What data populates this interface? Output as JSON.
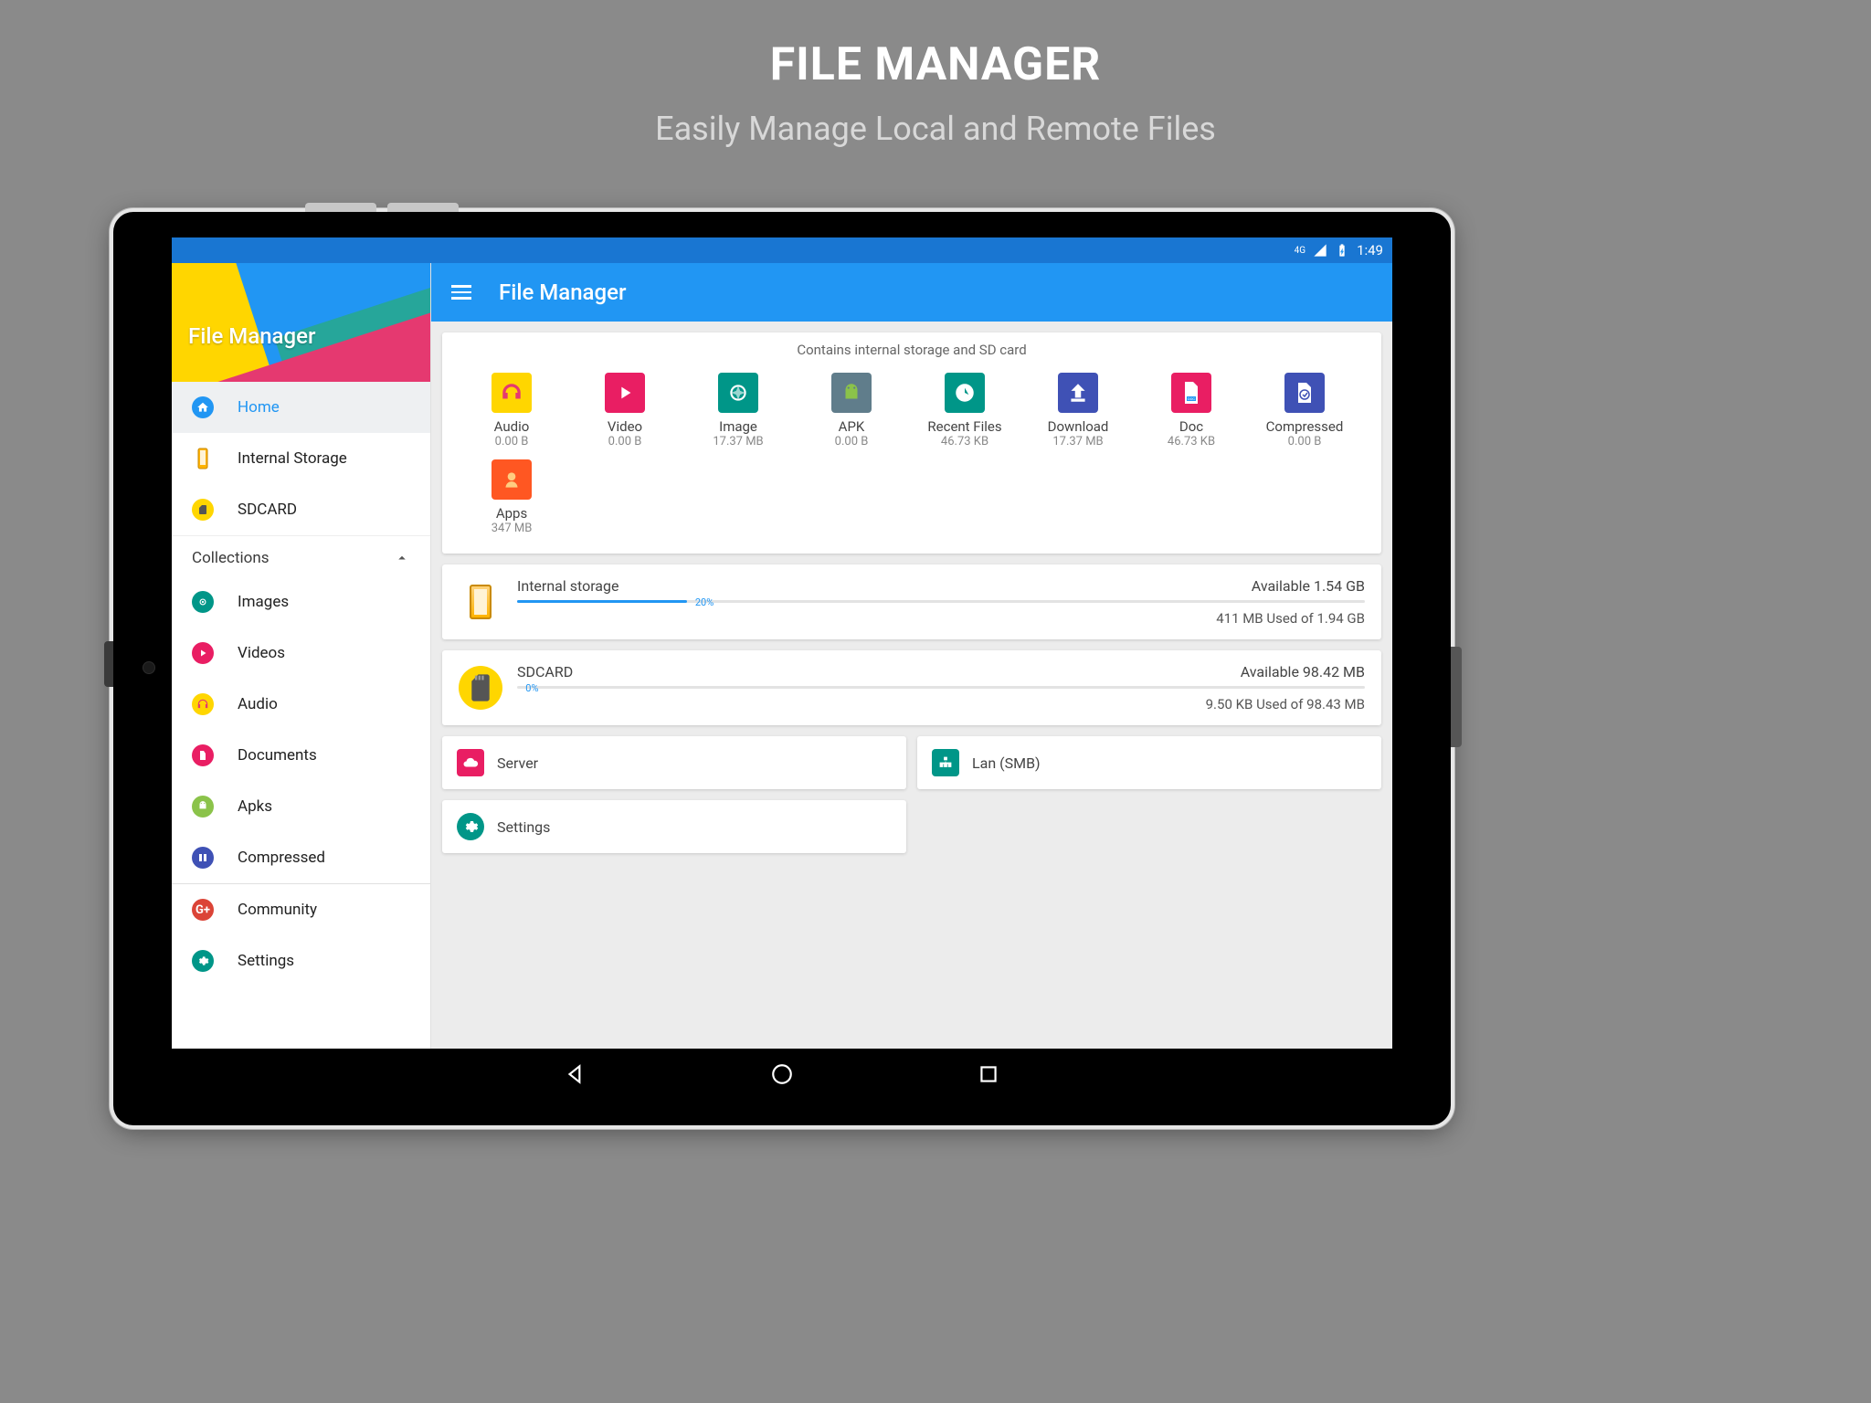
{
  "marketing": {
    "title": "FILE MANAGER",
    "subtitle": "Easily Manage Local and Remote Files"
  },
  "status": {
    "time": "1:49",
    "network_label": "4G"
  },
  "appbar": {
    "title": "File Manager"
  },
  "sidebar": {
    "header_title": "File Manager",
    "items_top": [
      {
        "label": "Home"
      },
      {
        "label": "Internal Storage"
      },
      {
        "label": "SDCARD"
      }
    ],
    "section_label": "Collections",
    "collections": [
      {
        "label": "Images"
      },
      {
        "label": "Videos"
      },
      {
        "label": "Audio"
      },
      {
        "label": "Documents"
      },
      {
        "label": "Apks"
      },
      {
        "label": "Compressed"
      }
    ],
    "footer": [
      {
        "label": "Community"
      },
      {
        "label": "Settings"
      }
    ]
  },
  "main": {
    "hint": "Contains internal storage and SD card",
    "categories": [
      {
        "label": "Audio",
        "size": "0.00 B"
      },
      {
        "label": "Video",
        "size": "0.00 B"
      },
      {
        "label": "Image",
        "size": "17.37 MB"
      },
      {
        "label": "APK",
        "size": "0.00 B"
      },
      {
        "label": "Recent Files",
        "size": "46.73 KB"
      },
      {
        "label": "Download",
        "size": "17.37 MB"
      },
      {
        "label": "Doc",
        "size": "46.73 KB"
      },
      {
        "label": "Compressed",
        "size": "0.00 B"
      },
      {
        "label": "Apps",
        "size": "347 MB"
      }
    ],
    "storages": [
      {
        "name": "Internal storage",
        "available": "Available 1.54 GB",
        "used": "411 MB Used of 1.94 GB",
        "pct": 20,
        "pct_label": "20%"
      },
      {
        "name": "SDCARD",
        "available": "Available 98.42 MB",
        "used": "9.50 KB Used of 98.43 MB",
        "pct": 0,
        "pct_label": "0%"
      }
    ],
    "network": [
      {
        "label": "Server"
      },
      {
        "label": "Lan (SMB)"
      }
    ],
    "settings_label": "Settings"
  }
}
